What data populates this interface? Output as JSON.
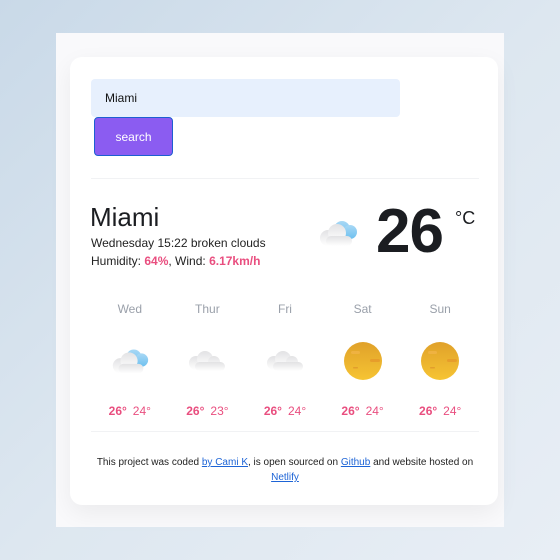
{
  "search": {
    "value": "Miami",
    "button_label": "search"
  },
  "current": {
    "city": "Miami",
    "day": "Wednesday",
    "time": "15:22",
    "description": "broken clouds",
    "humidity_label": "Humidity: ",
    "humidity": "64%",
    "wind_label": ", Wind: ",
    "wind": "6.17km/h",
    "icon": "broken-clouds-icon",
    "temperature": "26",
    "unit": "°C"
  },
  "forecast": [
    {
      "day": "Wed",
      "icon": "broken-clouds-icon",
      "max": "26°",
      "min": "24°"
    },
    {
      "day": "Thur",
      "icon": "clouds-icon",
      "max": "26°",
      "min": "23°"
    },
    {
      "day": "Fri",
      "icon": "clouds-icon",
      "max": "26°",
      "min": "24°"
    },
    {
      "day": "Sat",
      "icon": "sun-icon",
      "max": "26°",
      "min": "24°"
    },
    {
      "day": "Sun",
      "icon": "sun-icon",
      "max": "26°",
      "min": "24°"
    }
  ],
  "footer": {
    "text1": "This project was coded ",
    "link1": "by Cami K",
    "text2": ", is open sourced on ",
    "link2": "Github",
    "text3": " and website hosted on ",
    "link3": "Netlify"
  },
  "colors": {
    "accent": "#8b5cf1",
    "highlight": "#e94e7f",
    "link": "#1d64d6",
    "input_bg": "#e7f0fd"
  }
}
